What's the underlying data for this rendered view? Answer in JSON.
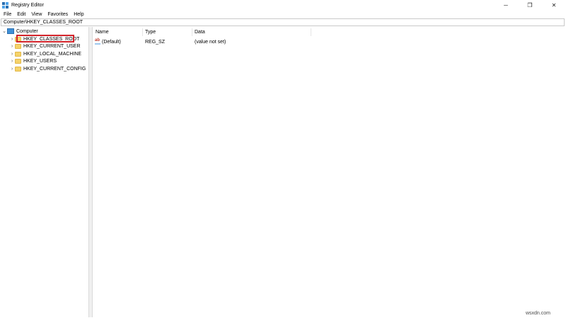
{
  "window": {
    "title": "Registry Editor",
    "controls": {
      "minimize": "─",
      "restore": "❐",
      "close": "✕"
    }
  },
  "menu": [
    "File",
    "Edit",
    "View",
    "Favorites",
    "Help"
  ],
  "address": "Computer\\HKEY_CLASSES_ROOT",
  "tree": {
    "root": "Computer",
    "root_chevron": "⌄",
    "child_chevron": "›",
    "children": [
      "HKEY_CLASSES_ROOT",
      "HKEY_CURRENT_USER",
      "HKEY_LOCAL_MACHINE",
      "HKEY_USERS",
      "HKEY_CURRENT_CONFIG"
    ],
    "selected": "HKEY_CLASSES_ROOT"
  },
  "list": {
    "columns": [
      "Name",
      "Type",
      "Data"
    ],
    "rows": [
      {
        "icon": "string-value-icon",
        "icon_text": "ab",
        "name": "(Default)",
        "type": "REG_SZ",
        "data": "(value not set)"
      }
    ]
  },
  "watermark": "wsxdn.com",
  "colors": {
    "highlight": "#d2232a",
    "folder": "#f5d36a",
    "computer": "#3f8fd6"
  }
}
